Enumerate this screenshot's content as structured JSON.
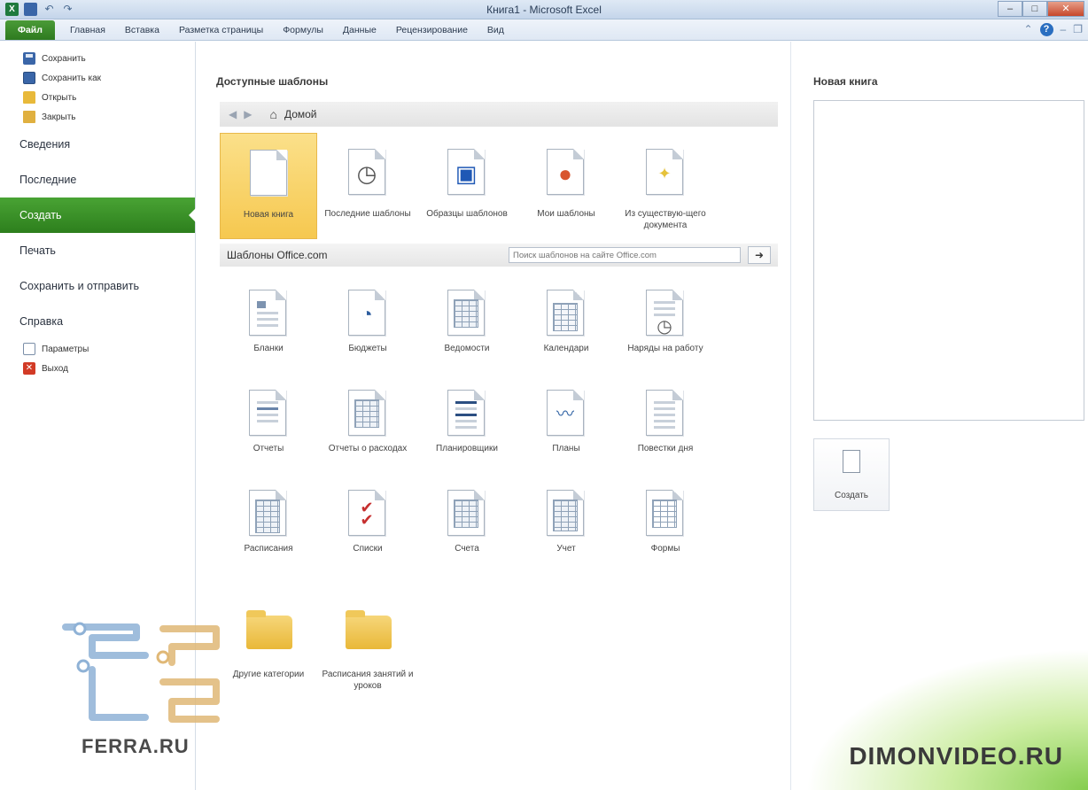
{
  "window": {
    "title": "Книга1 - Microsoft Excel"
  },
  "ribbon": {
    "tabs": [
      {
        "label": "Файл",
        "file": true
      },
      {
        "label": "Главная"
      },
      {
        "label": "Вставка"
      },
      {
        "label": "Разметка страницы"
      },
      {
        "label": "Формулы"
      },
      {
        "label": "Данные"
      },
      {
        "label": "Рецензирование"
      },
      {
        "label": "Вид"
      }
    ]
  },
  "leftnav": {
    "small_top": [
      {
        "label": "Сохранить",
        "icon": "save-icon"
      },
      {
        "label": "Сохранить как",
        "icon": "save-as-icon"
      },
      {
        "label": "Открыть",
        "icon": "open-folder-icon"
      },
      {
        "label": "Закрыть",
        "icon": "close-folder-icon"
      }
    ],
    "big": [
      {
        "label": "Сведения"
      },
      {
        "label": "Последние"
      },
      {
        "label": "Создать",
        "active": true
      },
      {
        "label": "Печать"
      },
      {
        "label": "Сохранить и отправить"
      },
      {
        "label": "Справка"
      }
    ],
    "small_bottom": [
      {
        "label": "Параметры",
        "icon": "options-icon"
      },
      {
        "label": "Выход",
        "icon": "exit-icon"
      }
    ]
  },
  "center": {
    "section_title": "Доступные шаблоны",
    "breadcrumb": "Домой",
    "top_tiles": [
      {
        "label": "Новая книга",
        "selected": true,
        "icon": "blank-document-icon"
      },
      {
        "label": "Последние шаблоны",
        "icon": "clock-document-icon"
      },
      {
        "label": "Образцы шаблонов",
        "icon": "sample-templates-icon"
      },
      {
        "label": "Мои шаблоны",
        "icon": "my-templates-icon"
      },
      {
        "label": "Из существую-щего документа",
        "icon": "from-existing-icon"
      }
    ],
    "office_bar_title": "Шаблоны Office.com",
    "search_placeholder": "Поиск шаблонов на сайте Office.com",
    "categories": [
      {
        "label": "Бланки"
      },
      {
        "label": "Бюджеты"
      },
      {
        "label": "Ведомости"
      },
      {
        "label": "Календари"
      },
      {
        "label": "Наряды на работу"
      },
      {
        "label": "Отчеты"
      },
      {
        "label": "Отчеты о расходах"
      },
      {
        "label": "Планировщики"
      },
      {
        "label": "Планы"
      },
      {
        "label": "Повестки дня"
      },
      {
        "label": "Расписания"
      },
      {
        "label": "Списки"
      },
      {
        "label": "Счета"
      },
      {
        "label": "Учет"
      },
      {
        "label": "Формы"
      }
    ],
    "folders": [
      {
        "label": "Другие категории"
      },
      {
        "label": "Расписания занятий и уроков"
      }
    ]
  },
  "right": {
    "title": "Новая книга",
    "create_label": "Создать"
  },
  "watermarks": {
    "left": "FERRA.RU",
    "right": "DIMONVIDEO.RU"
  }
}
